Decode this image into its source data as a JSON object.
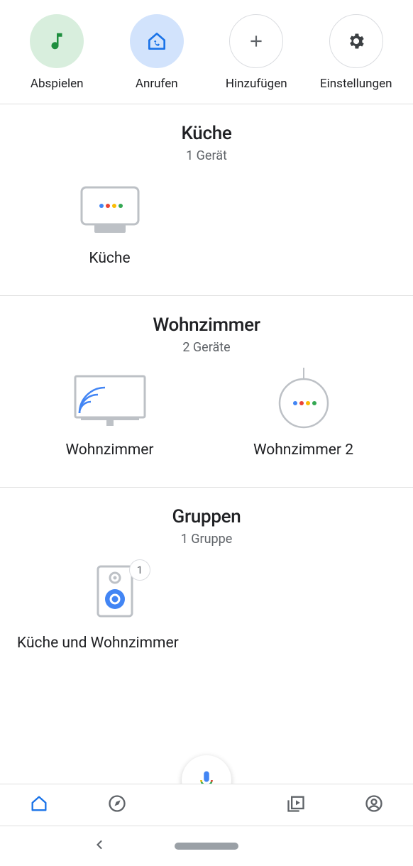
{
  "actions": {
    "play": {
      "label": "Abspielen"
    },
    "call": {
      "label": "Anrufen"
    },
    "add": {
      "label": "Hinzufügen"
    },
    "settings": {
      "label": "Einstellungen"
    }
  },
  "rooms": [
    {
      "title": "Küche",
      "subtitle": "1 Gerät",
      "devices": [
        {
          "label": "Küche",
          "type": "nest-hub"
        }
      ]
    },
    {
      "title": "Wohnzimmer",
      "subtitle": "2 Geräte",
      "devices": [
        {
          "label": "Wohnzimmer",
          "type": "chromecast-tv"
        },
        {
          "label": "Wohnzimmer 2",
          "type": "nest-mini"
        }
      ]
    }
  ],
  "groups": {
    "title": "Gruppen",
    "subtitle": "1 Gruppe",
    "items": [
      {
        "label": "Küche und Wohnzimmer",
        "type": "speaker-group",
        "count": "1"
      }
    ]
  }
}
